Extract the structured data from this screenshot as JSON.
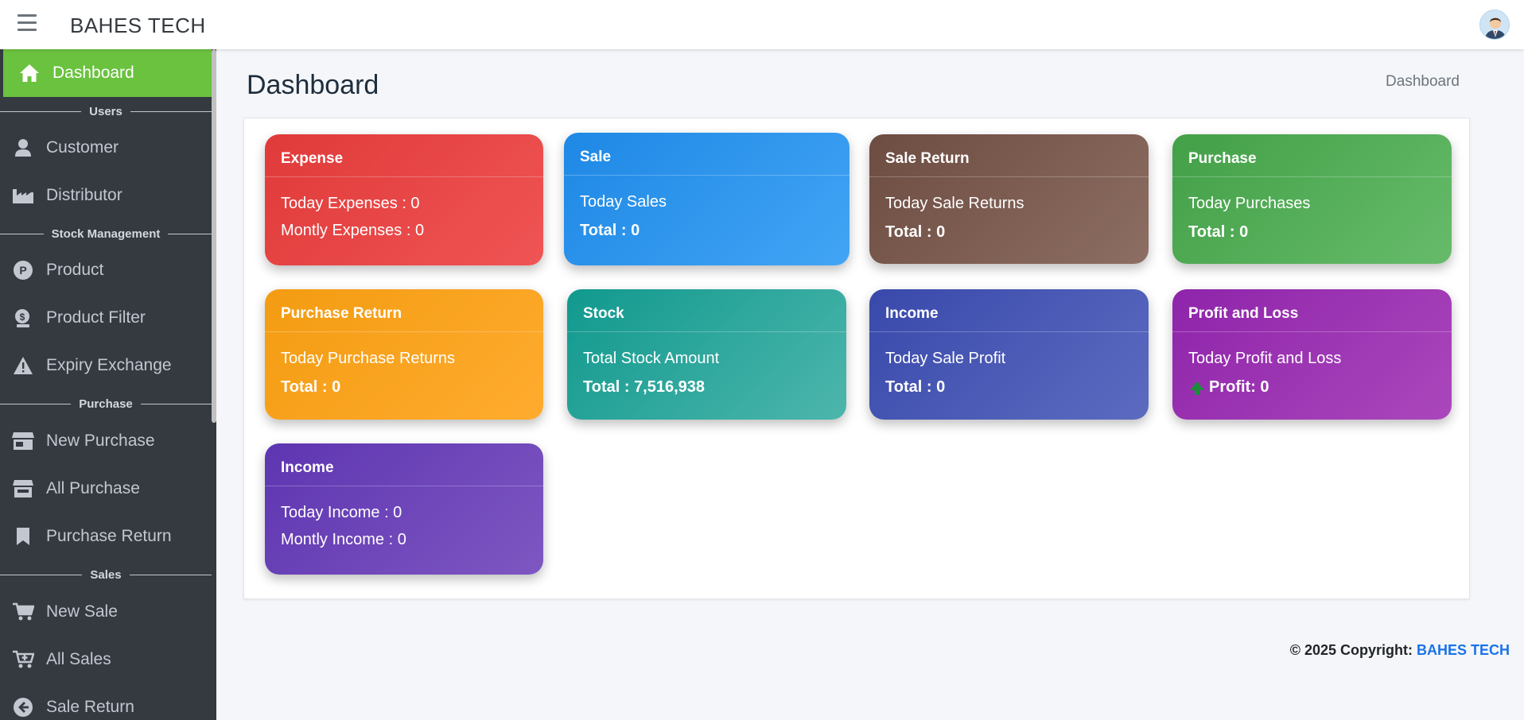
{
  "app": {
    "brand": "BAHES TECH"
  },
  "sidebar": {
    "dashboard": "Dashboard",
    "sections": {
      "users": "Users",
      "stock": "Stock Management",
      "purchase": "Purchase",
      "sales": "Sales"
    },
    "items": {
      "customer": "Customer",
      "distributor": "Distributor",
      "product": "Product",
      "product_filter": "Product Filter",
      "expiry_exchange": "Expiry Exchange",
      "new_purchase": "New Purchase",
      "all_purchase": "All Purchase",
      "purchase_return": "Purchase Return",
      "new_sale": "New Sale",
      "all_sales": "All Sales",
      "sale_return": "Sale Return"
    }
  },
  "page": {
    "title": "Dashboard",
    "breadcrumb": "Dashboard"
  },
  "cards": {
    "expense": {
      "title": "Expense",
      "line1": "Today Expenses : 0",
      "line2": "Montly Expenses : 0",
      "color_from": "#e03a3a",
      "color_to": "#f05454"
    },
    "sale": {
      "title": "Sale",
      "line1": "Today Sales",
      "line2": "Total : 0",
      "color_from": "#1e88e5",
      "color_to": "#42a5f5"
    },
    "sale_return": {
      "title": "Sale Return",
      "line1": "Today Sale Returns",
      "line2": "Total : 0",
      "color_from": "#6d4c41",
      "color_to": "#8d6e63"
    },
    "purchase": {
      "title": "Purchase",
      "line1": "Today Purchases",
      "line2": "Total : 0",
      "color_from": "#43a047",
      "color_to": "#66bb6a"
    },
    "purchase_return": {
      "title": "Purchase Return",
      "line1": "Today Purchase Returns",
      "line2": "Total : 0",
      "color_from": "#f39c12",
      "color_to": "#ffab2e"
    },
    "stock": {
      "title": "Stock",
      "line1": "Total Stock Amount",
      "line2": "Total : 7,516,938",
      "color_from": "#11998e",
      "color_to": "#4db6ac"
    },
    "income": {
      "title": "Income",
      "line1": "Today Sale Profit",
      "line2": "Total : 0",
      "color_from": "#3949ab",
      "color_to": "#5c6bc0"
    },
    "profit_loss": {
      "title": "Profit and Loss",
      "line1": "Today Profit and Loss",
      "line2": "Profit: 0",
      "color_from": "#8e24aa",
      "color_to": "#ab47bc"
    },
    "income2": {
      "title": "Income",
      "line1": "Today Income : 0",
      "line2": "Montly Income : 0",
      "color_from": "#5e35b1",
      "color_to": "#7e57c2"
    }
  },
  "footer": {
    "copyright": "© 2025 Copyright: ",
    "link": "BAHES TECH"
  }
}
